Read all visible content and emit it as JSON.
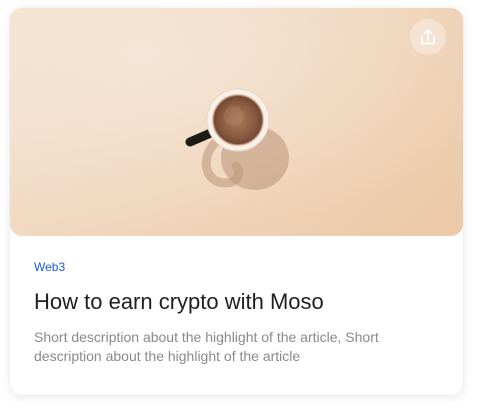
{
  "card": {
    "tag": "Web3",
    "title": "How to earn crypto with Moso",
    "description": "Short description about the highlight of the article, Short description about the highlight of the article"
  },
  "icons": {
    "share": "share-upload-icon",
    "image": "coffee-cup-photo"
  },
  "colors": {
    "tag": "#1a5bd6",
    "title": "#1f1f1f",
    "description": "#8a8a8a",
    "image_background": "#f0d6bd"
  }
}
